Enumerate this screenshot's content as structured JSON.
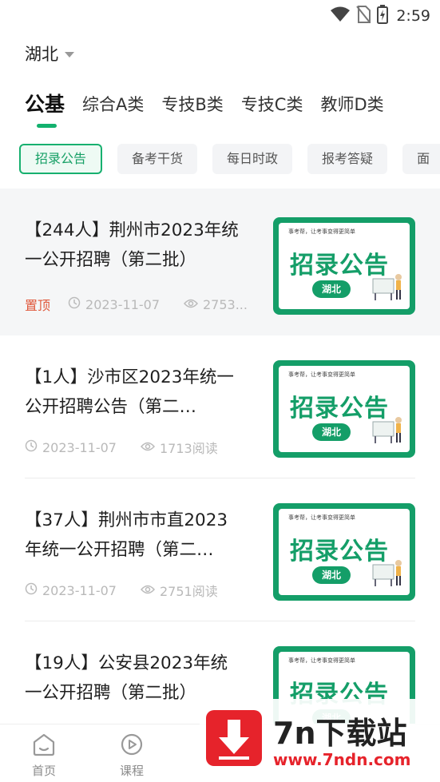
{
  "status_bar": {
    "time": "2:59"
  },
  "region": {
    "label": "湖北"
  },
  "category_tabs": [
    {
      "label": "公基"
    },
    {
      "label": "综合A类"
    },
    {
      "label": "专技B类"
    },
    {
      "label": "专技C类"
    },
    {
      "label": "教师D类"
    }
  ],
  "chips": [
    {
      "label": "招录公告"
    },
    {
      "label": "备考干货"
    },
    {
      "label": "每日时政"
    },
    {
      "label": "报考答疑"
    },
    {
      "label": "面"
    }
  ],
  "articles": [
    {
      "title": "【244人】荆州市2023年统一公开招聘（第二批）",
      "pin_label": "置顶",
      "date": "2023-11-07",
      "views": "2753..."
    },
    {
      "title": "【1人】沙市区2023年统一公开招聘公告（第二…",
      "date": "2023-11-07",
      "views": "1713阅读"
    },
    {
      "title": "【37人】荆州市市直2023年统一公开招聘（第二…",
      "date": "2023-11-07",
      "views": "2751阅读"
    },
    {
      "title": "【19人】公安县2023年统一公开招聘（第二批）",
      "date": "",
      "views": ""
    }
  ],
  "thumbnail": {
    "slogan": "事考帮，让考事变得更简单",
    "title": "招录公告",
    "badge": "湖北"
  },
  "bottom_nav": [
    {
      "label": "首页",
      "icon": "home-icon"
    },
    {
      "label": "课程",
      "icon": "play-circle-icon"
    }
  ],
  "watermark": {
    "name": "7n下载站",
    "url": "www.7ndn.com"
  },
  "colors": {
    "accent": "#13b16e",
    "pin": "#e0573a",
    "thumb_bg": "#149e68",
    "watermark": "#e6232b"
  }
}
